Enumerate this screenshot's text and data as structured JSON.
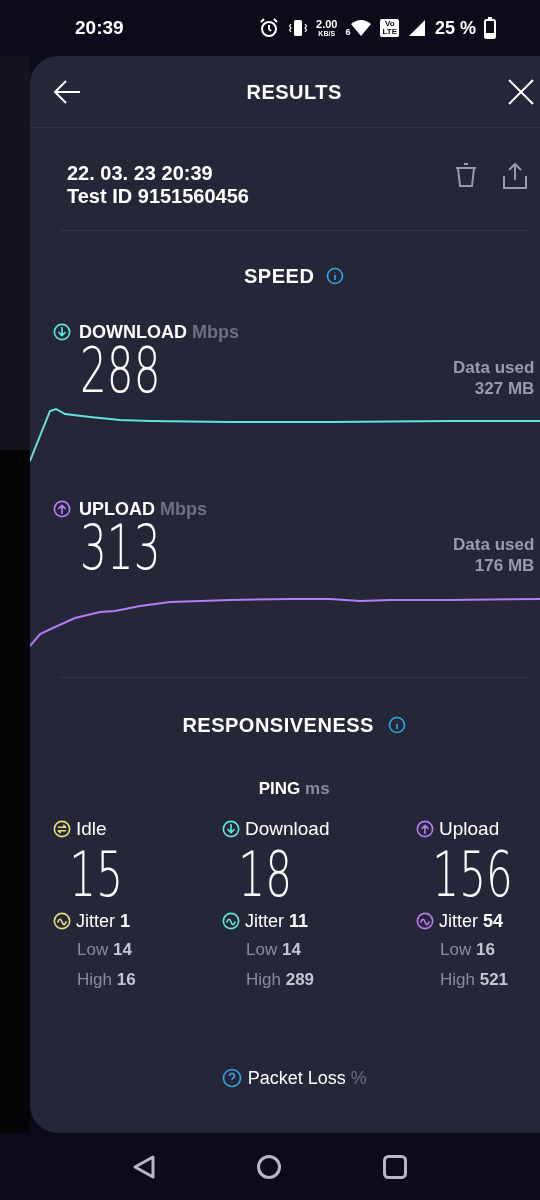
{
  "status_bar": {
    "time": "20:39",
    "net_speed_value": "2.00",
    "net_speed_unit": "KB/S",
    "wifi_label": "6",
    "volte_top": "Vo",
    "volte_bottom": "LTE",
    "battery": "25 %"
  },
  "header": {
    "title": "RESULTS"
  },
  "test": {
    "date": "22. 03. 23 20:39",
    "test_id": "Test ID 9151560456"
  },
  "speed": {
    "title": "SPEED",
    "metrics": [
      {
        "kind": "download",
        "label": "DOWNLOAD",
        "unit": "Mbps",
        "value": "288",
        "data_used_label": "Data used",
        "data_used_value": "327 MB",
        "color": "#5ee6d9"
      },
      {
        "kind": "upload",
        "label": "UPLOAD",
        "unit": "Mbps",
        "value": "313",
        "data_used_label": "Data used",
        "data_used_value": "176 MB",
        "color": "#b57cf0"
      }
    ]
  },
  "responsiveness": {
    "title": "RESPONSIVENESS",
    "ping_label": "PING",
    "ping_unit": "ms",
    "columns": [
      {
        "kind": "idle",
        "label": "Idle",
        "value": "15",
        "jitter_label": "Jitter",
        "jitter_value": "1",
        "low_label": "Low",
        "low_value": "14",
        "high_label": "High",
        "high_value": "16",
        "color": "#e6de7a"
      },
      {
        "kind": "download",
        "label": "Download",
        "value": "18",
        "jitter_label": "Jitter",
        "jitter_value": "11",
        "low_label": "Low",
        "low_value": "14",
        "high_label": "High",
        "high_value": "289",
        "color": "#5ee6d9"
      },
      {
        "kind": "upload",
        "label": "Upload",
        "value": "156",
        "jitter_label": "Jitter",
        "jitter_value": "54",
        "low_label": "Low",
        "low_value": "16",
        "high_label": "High",
        "high_value": "521",
        "color": "#b57cf0"
      }
    ]
  },
  "packet_loss": {
    "label": "Packet Loss",
    "unit": "%"
  }
}
